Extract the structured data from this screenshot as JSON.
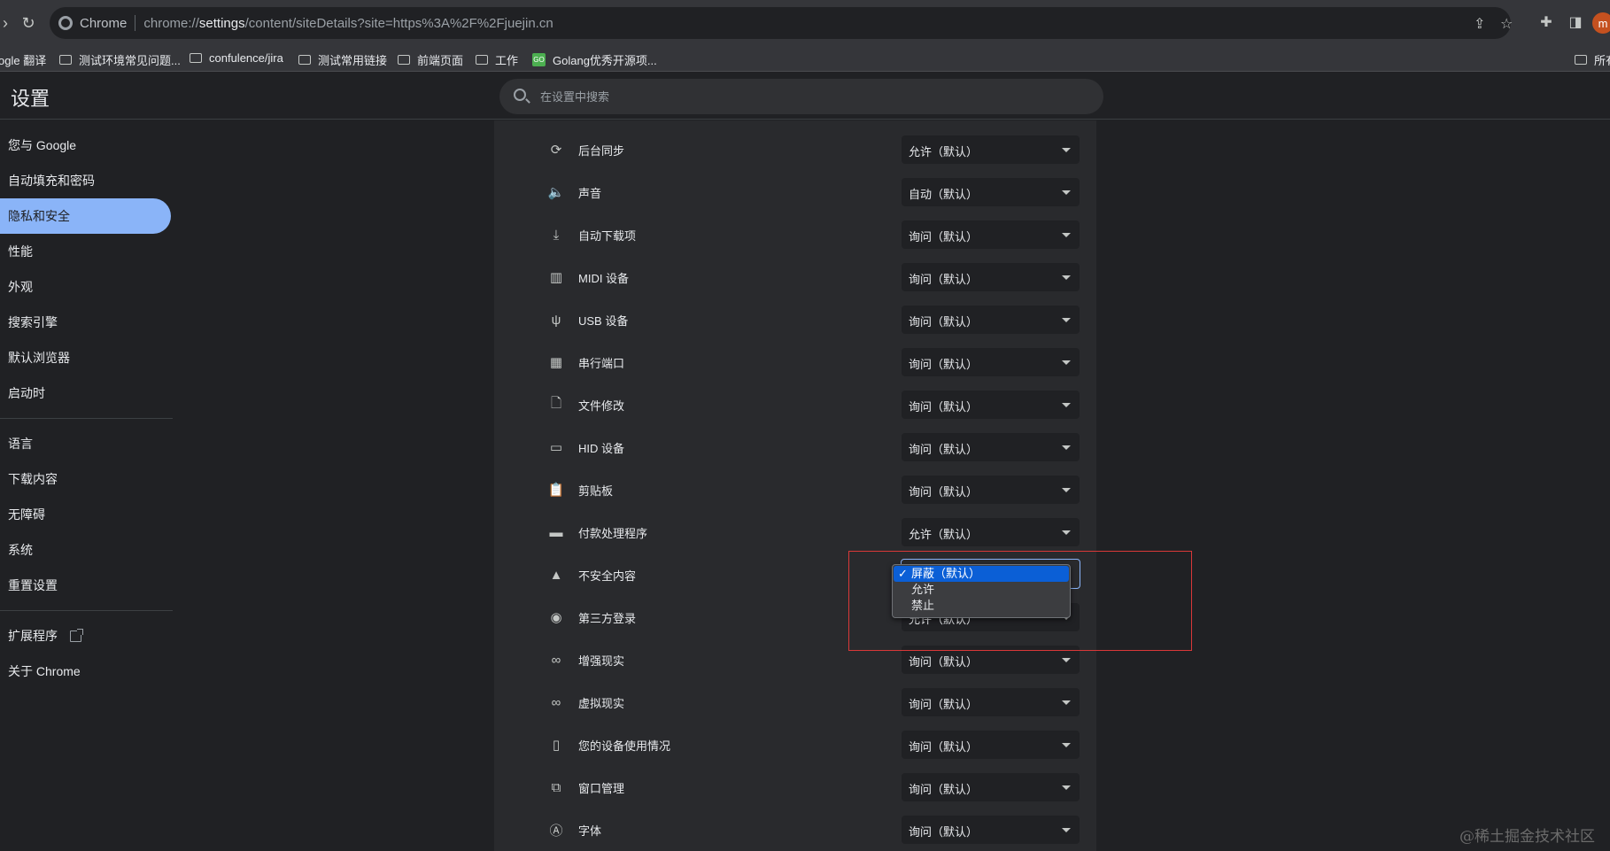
{
  "browser": {
    "site_name": "Chrome",
    "url_prefix": "chrome://",
    "url_host": "settings",
    "url_path": "/content/siteDetails?site=https%3A%2F%2Fjuejin.cn",
    "avatar_letter": "m"
  },
  "bookmarks": [
    {
      "label": "ogle 翻译",
      "kind": "text"
    },
    {
      "label": "测试环境常见问题...",
      "kind": "folder"
    },
    {
      "label": "confulence/jira",
      "kind": "folder"
    },
    {
      "label": "测试常用链接",
      "kind": "folder"
    },
    {
      "label": "前端页面",
      "kind": "folder"
    },
    {
      "label": "工作",
      "kind": "folder"
    },
    {
      "label": "Golang优秀开源项...",
      "kind": "go"
    },
    {
      "label": "所有",
      "kind": "folder"
    }
  ],
  "header": {
    "title": "设置",
    "search_placeholder": "在设置中搜索"
  },
  "sidebar": {
    "items": [
      {
        "label": "您与 Google"
      },
      {
        "label": "自动填充和密码"
      },
      {
        "label": "隐私和安全"
      },
      {
        "label": "性能"
      },
      {
        "label": "外观"
      },
      {
        "label": "搜索引擎"
      },
      {
        "label": "默认浏览器"
      },
      {
        "label": "启动时"
      },
      {
        "label": "语言"
      },
      {
        "label": "下载内容"
      },
      {
        "label": "无障碍"
      },
      {
        "label": "系统"
      },
      {
        "label": "重置设置"
      },
      {
        "label": "扩展程序"
      },
      {
        "label": "关于 Chrome"
      }
    ],
    "active_index": 2
  },
  "permissions": [
    {
      "label": "后台同步",
      "value": "允许（默认）",
      "icon": "sync-icon"
    },
    {
      "label": "声音",
      "value": "自动（默认）",
      "icon": "speaker-icon"
    },
    {
      "label": "自动下载项",
      "value": "询问（默认）",
      "icon": "download-icon"
    },
    {
      "label": "MIDI 设备",
      "value": "询问（默认）",
      "icon": "piano-icon"
    },
    {
      "label": "USB 设备",
      "value": "询问（默认）",
      "icon": "usb-icon"
    },
    {
      "label": "串行端口",
      "value": "询问（默认）",
      "icon": "serial-port-icon"
    },
    {
      "label": "文件修改",
      "value": "询问（默认）",
      "icon": "file-edit-icon"
    },
    {
      "label": "HID 设备",
      "value": "询问（默认）",
      "icon": "gamepad-icon"
    },
    {
      "label": "剪贴板",
      "value": "询问（默认）",
      "icon": "clipboard-icon"
    },
    {
      "label": "付款处理程序",
      "value": "允许（默认）",
      "icon": "credit-card-icon"
    },
    {
      "label": "不安全内容",
      "value": "屏蔽（默认）",
      "icon": "warning-icon"
    },
    {
      "label": "第三方登录",
      "value": "允许（默认）",
      "icon": "account-circle-icon"
    },
    {
      "label": "增强现实",
      "value": "询问（默认）",
      "icon": "ar-headset-icon"
    },
    {
      "label": "虚拟现实",
      "value": "询问（默认）",
      "icon": "vr-headset-icon"
    },
    {
      "label": "您的设备使用情况",
      "value": "询问（默认）",
      "icon": "devices-icon"
    },
    {
      "label": "窗口管理",
      "value": "询问（默认）",
      "icon": "window-icon"
    },
    {
      "label": "字体",
      "value": "询问（默认）",
      "icon": "font-icon"
    }
  ],
  "dropdown": {
    "for": "不安全内容",
    "options": [
      "屏蔽（默认）",
      "允许",
      "禁止"
    ],
    "selected_index": 0
  },
  "watermark": "@稀土掘金技术社区",
  "colors": {
    "accent": "#8ab4f8",
    "selected_option": "#0b5fd6",
    "annotation_box": "#d93838"
  }
}
